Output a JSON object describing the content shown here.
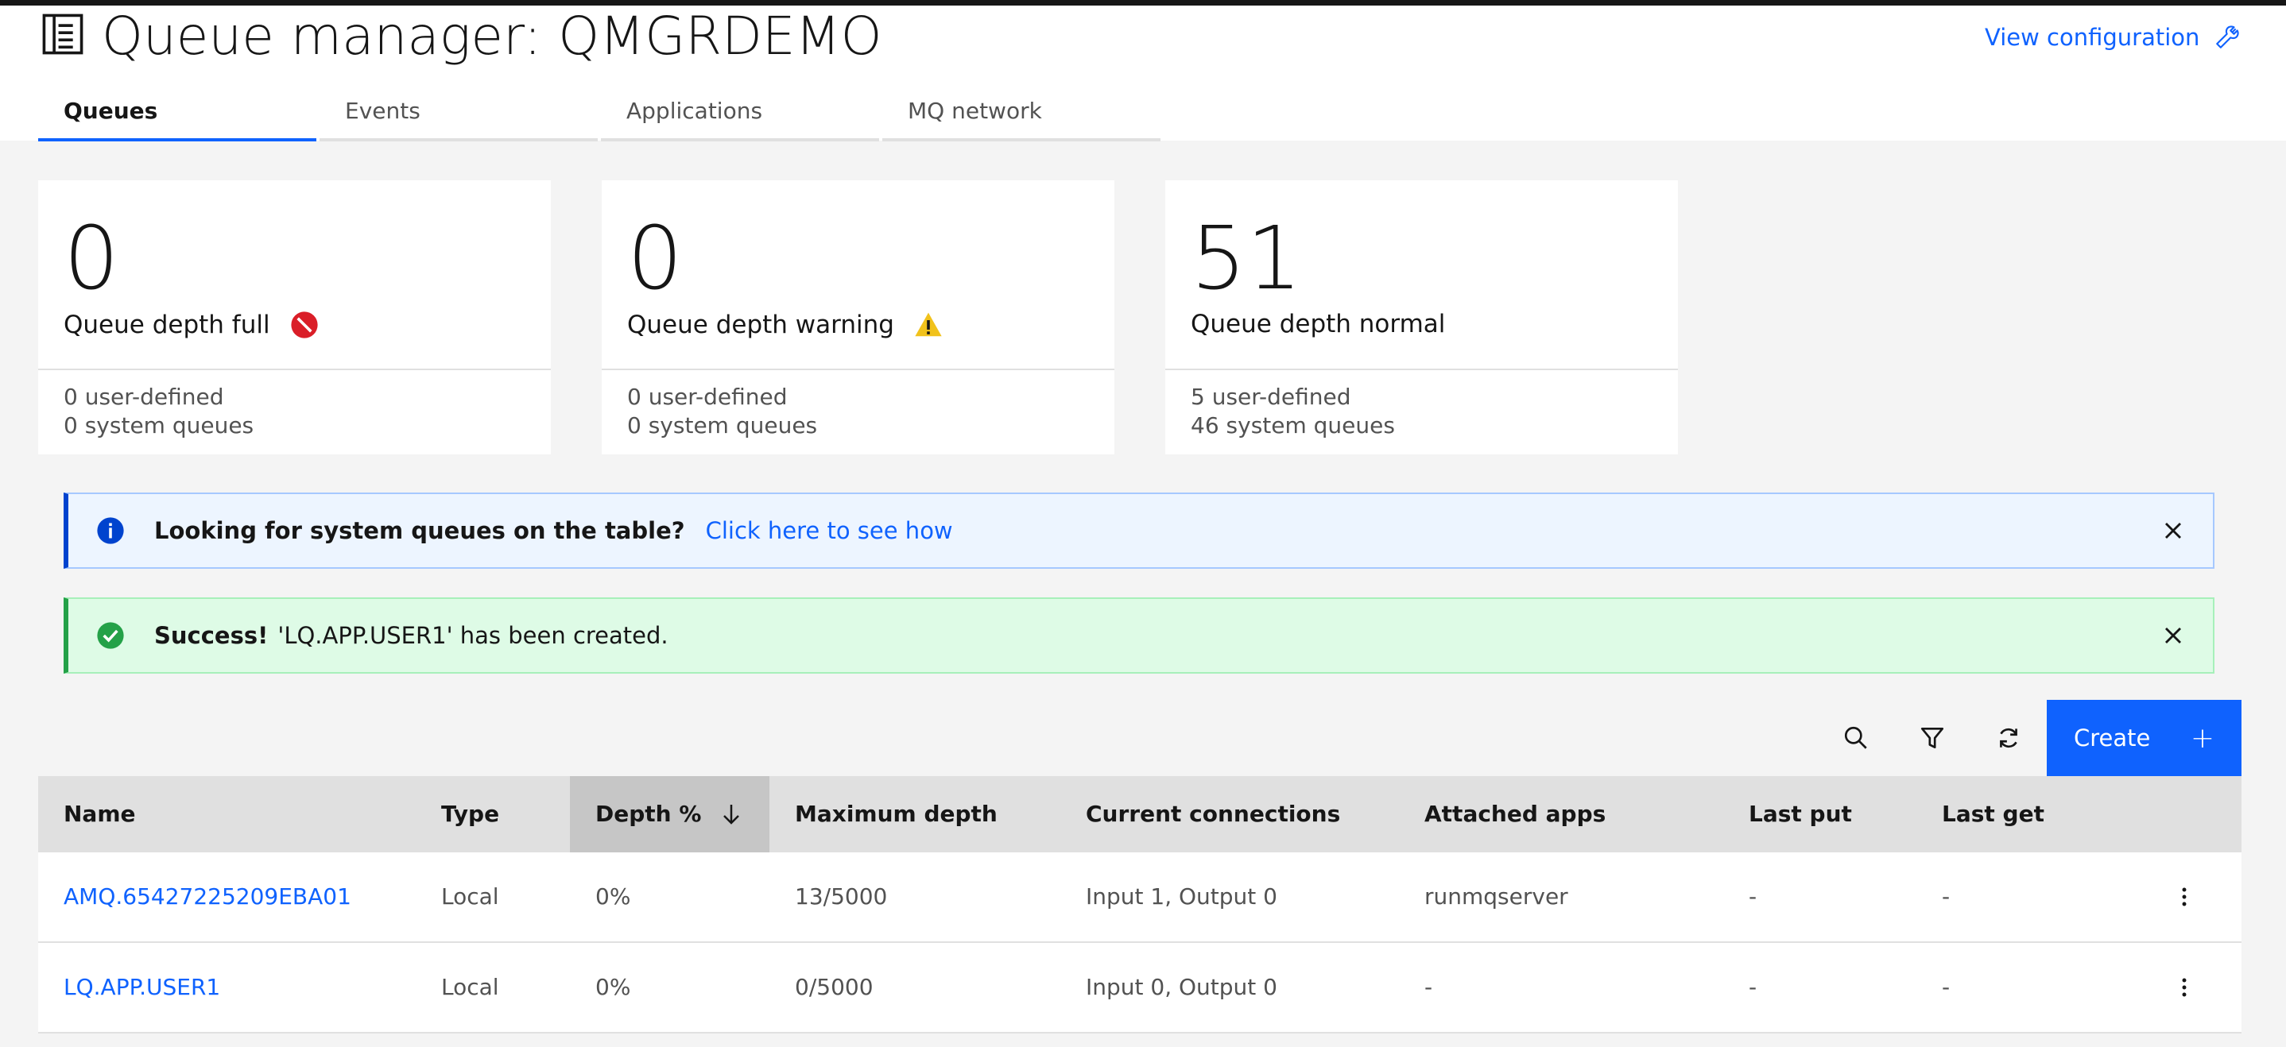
{
  "page": {
    "title": "Queue manager: QMGRDEMO",
    "view_configuration": "View configuration"
  },
  "tabs": [
    {
      "label": "Queues",
      "active": true
    },
    {
      "label": "Events",
      "active": false
    },
    {
      "label": "Applications",
      "active": false
    },
    {
      "label": "MQ network",
      "active": false
    }
  ],
  "cards": [
    {
      "number": "0",
      "label": "Queue depth full",
      "icon": "error-icon",
      "user_defined": "0  user-defined",
      "system_queues": "0  system queues"
    },
    {
      "number": "0",
      "label": "Queue depth warning",
      "icon": "warning-icon",
      "user_defined": "0  user-defined",
      "system_queues": "0  system queues"
    },
    {
      "number": "51",
      "label": "Queue depth normal",
      "icon": "",
      "user_defined": "5  user-defined",
      "system_queues": "46  system queues"
    }
  ],
  "notifications": {
    "info": {
      "title": "Looking for system queues on the table?",
      "link": "Click here to see how"
    },
    "success": {
      "title": "Success!",
      "text": "'LQ.APP.USER1' has been created."
    }
  },
  "toolbar": {
    "create_label": "Create",
    "create_icon": "+"
  },
  "table": {
    "columns": [
      "Name",
      "Type",
      "Depth %",
      "Maximum depth",
      "Current connections",
      "Attached apps",
      "Last put",
      "Last get"
    ],
    "sorted_column": "Depth %",
    "rows": [
      {
        "name": "AMQ.65427225209EBA01",
        "type": "Local",
        "depth": "0%",
        "max_depth": "13/5000",
        "connections": "Input 1, Output 0",
        "apps": "runmqserver",
        "last_put": "-",
        "last_get": "-"
      },
      {
        "name": "LQ.APP.USER1",
        "type": "Local",
        "depth": "0%",
        "max_depth": "0/5000",
        "connections": "Input 0, Output 0",
        "apps": "-",
        "last_put": "-",
        "last_get": "-"
      }
    ]
  },
  "colors": {
    "primary": "#0f62fe",
    "error": "#da1e28",
    "warning": "#f1c21b",
    "success": "#24a148",
    "info": "#0043ce"
  }
}
